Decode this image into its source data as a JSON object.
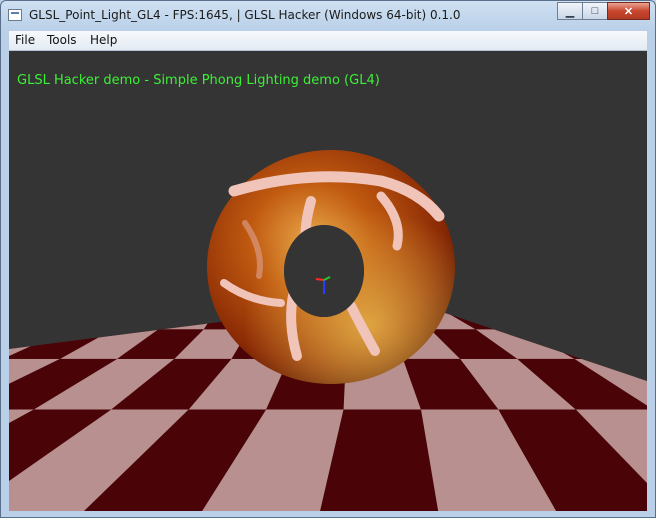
{
  "window": {
    "title": "GLSL_Point_Light_GL4 - FPS:1645,  | GLSL Hacker (Windows 64-bit) 0.1.0"
  },
  "menu": {
    "items": [
      {
        "label": "File"
      },
      {
        "label": "Tools"
      },
      {
        "label": "Help"
      }
    ]
  },
  "viewport": {
    "overlay_text": "GLSL Hacker demo - Simple Phong Lighting demo (GL4)",
    "overlay_color": "#3cf036",
    "background_color": "#343434"
  },
  "colors": {
    "torus_base": "#8a2a05",
    "torus_highlight": "#e0a040",
    "stripe": "#f0c4b8",
    "tile_light": "#b89090",
    "tile_dark": "#4a0408"
  }
}
